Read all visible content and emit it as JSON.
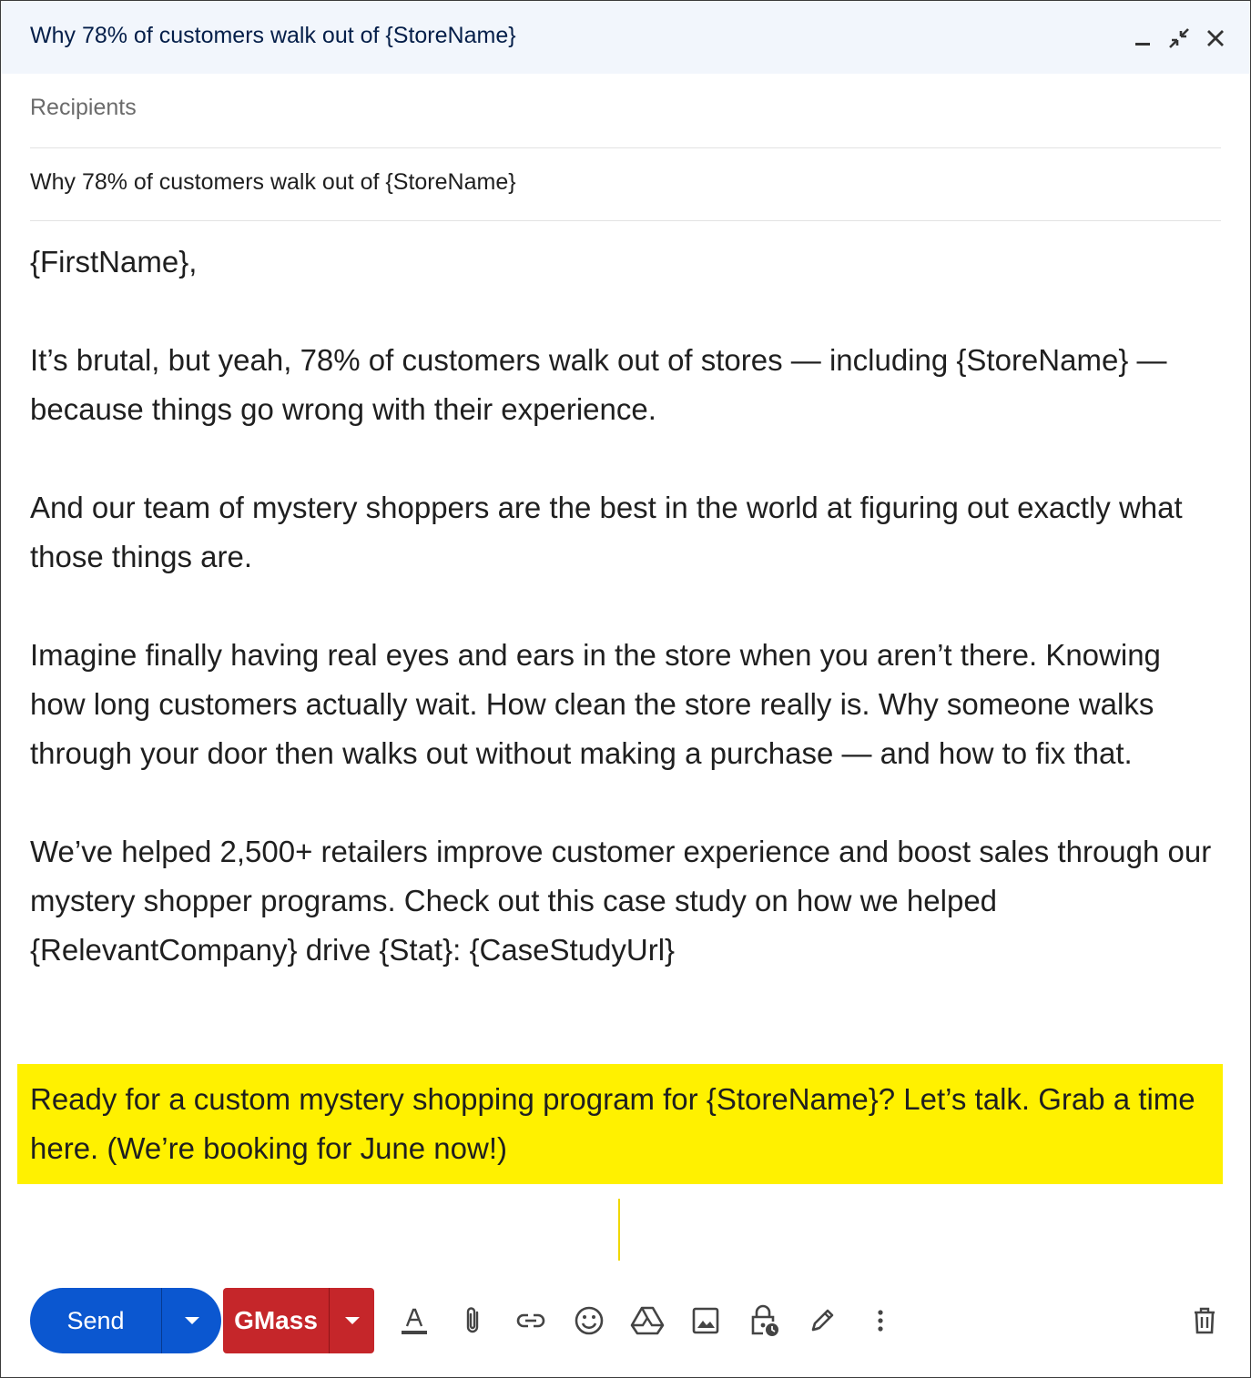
{
  "window": {
    "title": "Why 78% of customers walk out of {StoreName}"
  },
  "compose": {
    "recipients_placeholder": "Recipients",
    "subject": "Why 78% of customers walk out of {StoreName}",
    "body": {
      "greeting": "{FirstName},",
      "paragraph_1": "It’s brutal, but yeah, 78% of customers walk out of stores — including {StoreName} — because things go wrong with their experience.",
      "paragraph_2": "And our team of mystery shoppers are the best in the world at figuring out exactly what those things are.",
      "paragraph_3": "Imagine finally having real eyes and ears in the store when you aren’t there. Knowing how long customers actually wait. How clean the store really is. Why someone walks through your door then walks out without making a purchase — and how to fix that.",
      "paragraph_4": "We’ve helped 2,500+ retailers improve customer experience and boost sales through our mystery shopper programs. Check out this case study on how we helped {RelevantCompany} drive {Stat}: {CaseStudyUrl}",
      "highlighted": "Ready for a custom mystery shopping program for {StoreName}? Let’s talk. Grab a time here. (We’re booking for June now!)"
    }
  },
  "toolbar": {
    "send_label": "Send",
    "gmass_label": "GMass",
    "icons": [
      "formatting-icon",
      "attach-icon",
      "link-icon",
      "emoji-icon",
      "drive-icon",
      "photo-icon",
      "confidential-icon",
      "signature-icon",
      "more-options-icon",
      "discard-icon"
    ]
  },
  "colors": {
    "send_button": "#0b57d0",
    "gmass_button": "#c5262a",
    "highlight": "#fff100",
    "titlebar_bg": "#f2f6fc"
  }
}
